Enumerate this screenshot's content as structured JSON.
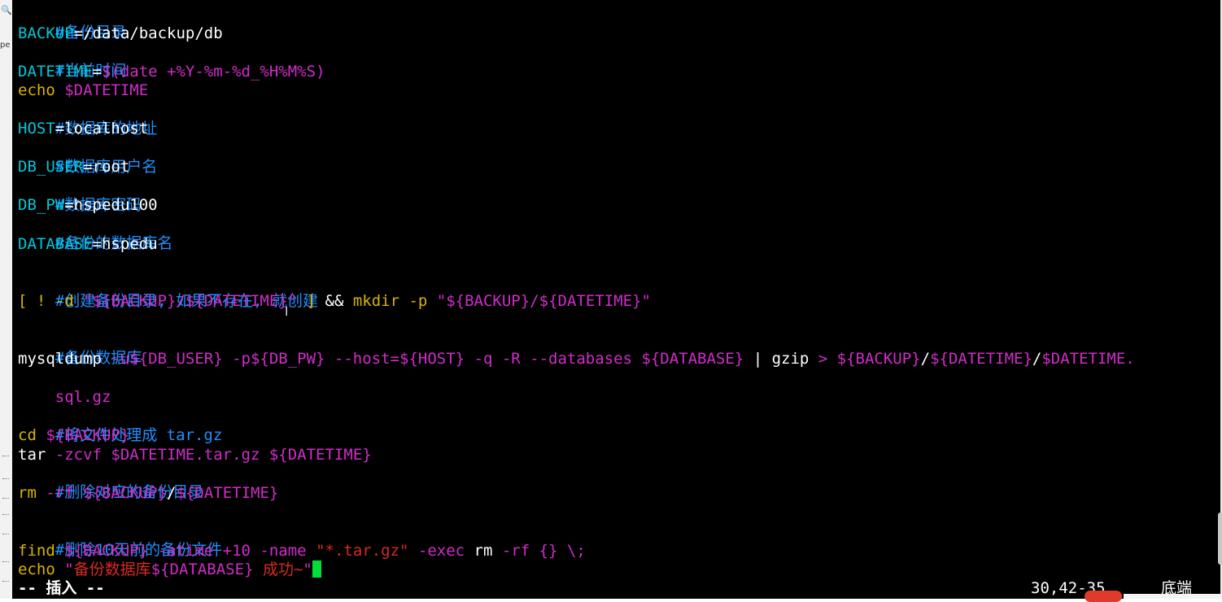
{
  "sidebar": {
    "magnifier_glyph": "🔍",
    "label": "pe"
  },
  "editor": {
    "lines": {
      "l1": {
        "text": "#备份目录"
      },
      "l2": {
        "var": "BACKUP",
        "value": "=/data/backup/db"
      },
      "l3": {
        "text": "#当前时间"
      },
      "l4": {
        "var": "DATETIME",
        "eq": "=",
        "value": "$(date +%Y-%m-%d_%H%M%S)"
      },
      "l5": {
        "cmd": "echo",
        "arg": "$DATETIME"
      },
      "l6": {
        "text": "#数据库的地址"
      },
      "l7": {
        "var": "HOST",
        "value": "=localhost"
      },
      "l8": {
        "text": "#数据库用户名"
      },
      "l9": {
        "var": "DB_USER",
        "value": "=root"
      },
      "l10": {
        "text": "#数据库密码"
      },
      "l11": {
        "var": "DB_PW",
        "value": "=hspedu100"
      },
      "l12": {
        "text": "#备份的数据库名"
      },
      "l13": {
        "var": "DATABASE",
        "value": "=hspedu"
      },
      "l15": {
        "text": "#创建备份目录, 如果不存在, 就创建"
      },
      "l16": {
        "p1": "[ ! -d ",
        "p2": "\"${BACKUP}/${DATETIME}\"",
        "p3": " ] ",
        "p4": "&&",
        "p5": " mkdir -p ",
        "p6": "\"${BACKUP}/${DATETIME}\""
      },
      "l18": {
        "text": "#备份数据库"
      },
      "l19": {
        "p1": "mysqldump",
        "p2": " -u${DB_USER} -p${DB_PW} --host=${HOST} -q -R --databases ${DATABASE} ",
        "p3": "| gzip",
        "p4": " > ${BACKUP}",
        "p5": "/",
        "p6": "${DATETIME}",
        "p7": "/",
        "p8": "$DATETIME."
      },
      "l20": {
        "text": "sql.gz"
      },
      "l22": {
        "text": "#将文件处理成 tar.gz"
      },
      "l23": {
        "cmd": "cd",
        "arg": " ${BACKUP}"
      },
      "l24": {
        "cmd": "tar",
        "arg": " -zcvf $DATETIME.tar.gz ${DATETIME}"
      },
      "l25": {
        "text": "#删除对应的备份目录"
      },
      "l26": {
        "cmd": "rm",
        "arg": " -rf ${BACKUP}",
        "sep": "/",
        "arg2": "${DATETIME}"
      },
      "l28": {
        "text": "#删除10天前的备份文件"
      },
      "l29": {
        "p1": "find",
        "p2": " ${BACKUP} -atime +10 -name ",
        "p3": "\"*.tar.gz\"",
        "p4": " -exec ",
        "p5": "rm",
        "p6": " -rf {} \\;"
      },
      "l30": {
        "p1": "echo",
        "p2": " \"",
        "p3": "备份数据库",
        "p4": "${DATABASE}",
        "p5": " 成功~",
        "p6": "\""
      }
    }
  },
  "status": {
    "mode": "-- 插入 --",
    "position": "30,42-35",
    "scroll": "底端"
  },
  "colors": {
    "background": "#000000",
    "comment": "#1e90ff",
    "variable": "#00c8d8",
    "keyword": "#d7b500",
    "string": "#d02cc8",
    "cursor": "#00e03a"
  }
}
